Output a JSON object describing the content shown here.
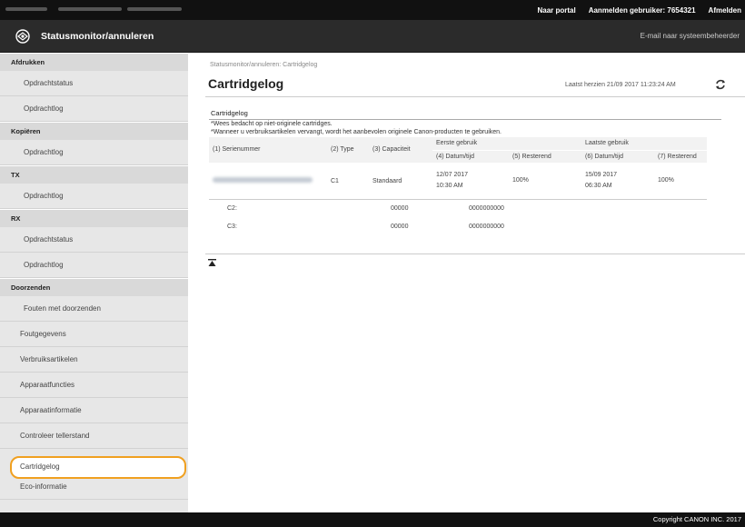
{
  "topbar": {
    "portal_link": "Naar portal",
    "login_user_label": "Aanmelden gebruiker: 7654321",
    "logout_link": "Afmelden"
  },
  "titlebar": {
    "app_title": "Statusmonitor/annuleren",
    "mail_admin_link": "E-mail naar systeembeheerder"
  },
  "sidebar": {
    "sections": [
      {
        "title": "Afdrukken",
        "items": [
          "Opdrachtstatus",
          "Opdrachtlog"
        ]
      },
      {
        "title": "Kopiëren",
        "items": [
          "Opdrachtlog"
        ]
      },
      {
        "title": "TX",
        "items": [
          "Opdrachtlog"
        ]
      },
      {
        "title": "RX",
        "items": [
          "Opdrachtstatus",
          "Opdrachtlog"
        ]
      },
      {
        "title": "Doorzenden",
        "items": [
          "Fouten met doorzenden"
        ]
      }
    ],
    "plain_items": [
      "Foutgegevens",
      "Verbruiksartikelen",
      "Apparaatfuncties",
      "Apparaatinformatie",
      "Controleer tellerstand",
      "Cartridgelog",
      "Eco-informatie"
    ],
    "selected": "Cartridgelog"
  },
  "main": {
    "breadcrumb": "Statusmonitor/annuleren: Cartridgelog",
    "title": "Cartridgelog",
    "last_update": "Laatst herzien 21/09 2017 11:23:24 AM",
    "section_title": "Cartridgelog",
    "note1": "*Wees bedacht op niet-originele cartridges.",
    "note2": "*Wanneer u verbruiksartikelen vervangt, wordt het aanbevolen originele Canon-producten te gebruiken.",
    "table": {
      "headers": {
        "serial": "(1) Serienummer",
        "type": "(2) Type",
        "capacity": "(3) Capaciteit",
        "first_use": "Eerste gebruik",
        "last_use": "Laatste gebruik",
        "first_datetime": "(4) Datum/tijd",
        "first_remaining": "(5) Resterend",
        "last_datetime": "(6) Datum/tijd",
        "last_remaining": "(7) Resterend"
      },
      "rows": [
        {
          "type": "C1",
          "capacity": "Standaard",
          "first_date": "12/07 2017",
          "first_time": "10:30 AM",
          "first_remaining": "100%",
          "last_date": "15/09 2017",
          "last_time": "06:30 AM",
          "last_remaining": "100%"
        }
      ],
      "summary_rows": [
        {
          "label": "C2:",
          "count": "00000",
          "value": "0000000000"
        },
        {
          "label": "C3:",
          "count": "00000",
          "value": "0000000000"
        }
      ]
    }
  },
  "footer": {
    "copyright": "Copyright CANON INC. 2017"
  },
  "colors": {
    "topbar": "#111111",
    "titlebar": "#2b2b2b",
    "sidebar": "#e7e7e7",
    "selection_outline": "#f0a020"
  },
  "icons": {
    "logo": "canon-logo-icon",
    "refresh": "refresh-icon",
    "to_top": "to-top-icon"
  }
}
